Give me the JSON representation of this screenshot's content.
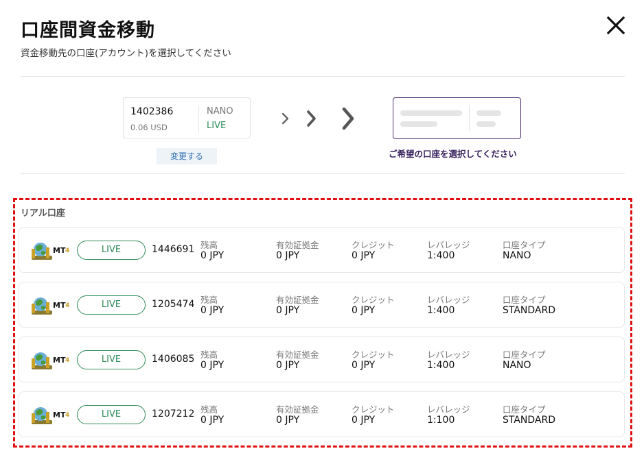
{
  "header": {
    "title": "口座間資金移動",
    "subtitle": "資金移動先の口座(アカウント)を選択してください",
    "close_label": "×"
  },
  "source_account": {
    "number": "1402386",
    "balance": "0.06 USD",
    "type": "NANO",
    "status": "LIVE",
    "change_label": "変更する"
  },
  "destination": {
    "caption": "ご希望の口座を選択してください"
  },
  "accounts_section": {
    "title": "リアル口座",
    "field_labels": {
      "balance": "残高",
      "margin": "有効証拠金",
      "credit": "クレジット",
      "leverage": "レバレッジ",
      "account_type": "口座タイプ"
    },
    "accounts": [
      {
        "platform": "MT4",
        "status": "LIVE",
        "number": "1446691",
        "balance": "0 JPY",
        "margin": "0 JPY",
        "credit": "0 JPY",
        "leverage": "1:400",
        "account_type": "NANO"
      },
      {
        "platform": "MT4",
        "status": "LIVE",
        "number": "1205474",
        "balance": "0 JPY",
        "margin": "0 JPY",
        "credit": "0 JPY",
        "leverage": "1:400",
        "account_type": "STANDARD"
      },
      {
        "platform": "MT4",
        "status": "LIVE",
        "number": "1406085",
        "balance": "0 JPY",
        "margin": "0 JPY",
        "credit": "0 JPY",
        "leverage": "1:400",
        "account_type": "NANO"
      },
      {
        "platform": "MT4",
        "status": "LIVE",
        "number": "1207212",
        "balance": "0 JPY",
        "margin": "0 JPY",
        "credit": "0 JPY",
        "leverage": "1:100",
        "account_type": "STANDARD"
      }
    ]
  },
  "colors": {
    "live_green": "#2c8a57",
    "accent_purple": "#4b2e73",
    "highlight_red": "#e01010",
    "link_blue": "#2f6fb5"
  },
  "icons": {
    "close": "close-icon",
    "arrows": "chevron-right-icon",
    "platform": "mt4-logo-icon"
  }
}
